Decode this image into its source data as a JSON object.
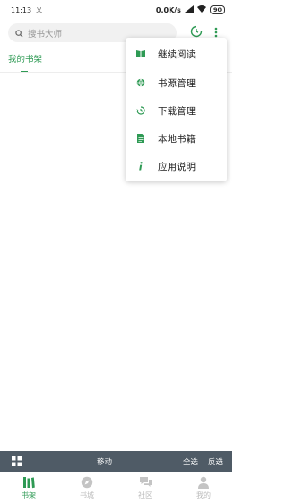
{
  "status_bar": {
    "time": "11:13",
    "notify": "乂",
    "network_speed": "0.0K/s",
    "battery": "90"
  },
  "search": {
    "placeholder": "搜书大师"
  },
  "tabs": {
    "active_label": "我的书架"
  },
  "menu": {
    "items": [
      {
        "label": "继续阅读",
        "icon": "book-open-icon"
      },
      {
        "label": "书源管理",
        "icon": "globe-icon"
      },
      {
        "label": "下载管理",
        "icon": "history-icon"
      },
      {
        "label": "本地书籍",
        "icon": "document-icon"
      },
      {
        "label": "应用说明",
        "icon": "info-icon"
      }
    ]
  },
  "action_bar": {
    "move_label": "移动",
    "select_all_label": "全选",
    "invert_label": "反选"
  },
  "bottom_nav": {
    "items": [
      {
        "label": "书架",
        "icon": "bookshelf-icon",
        "active": true
      },
      {
        "label": "书城",
        "icon": "discover-icon",
        "active": false
      },
      {
        "label": "社区",
        "icon": "chat-icon",
        "active": false
      },
      {
        "label": "我的",
        "icon": "user-icon",
        "active": false
      }
    ]
  },
  "colors": {
    "accent": "#2e9a54",
    "action_bar_bg": "#4f5b66",
    "inactive_nav": "#bbbbbb"
  }
}
